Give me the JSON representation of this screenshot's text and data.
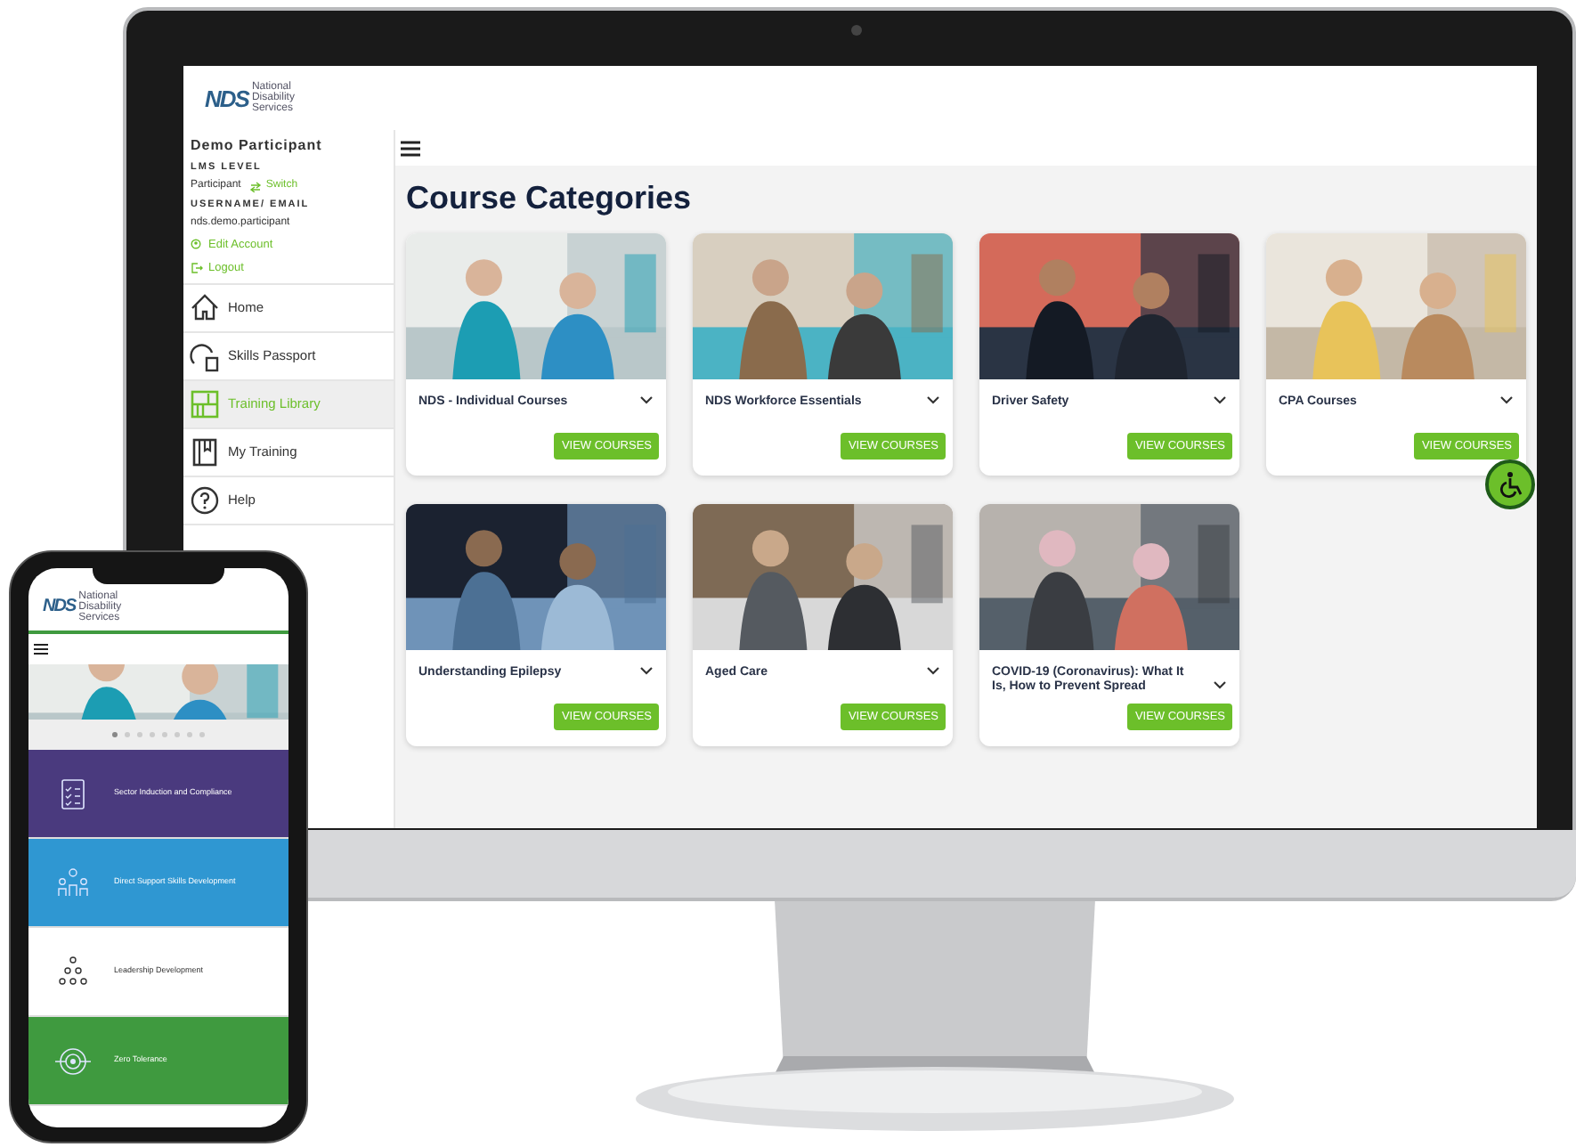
{
  "desktop": {
    "logo": {
      "mark": "NDS",
      "lines": [
        "National",
        "Disability",
        "Services"
      ]
    },
    "user": {
      "name": "Demo Participant",
      "level_label": "LMS LEVEL",
      "level": "Participant",
      "switch": "Switch",
      "username_label": "USERNAME/ EMAIL",
      "username": "nds.demo.participant",
      "links": [
        "Edit Account",
        "Logout"
      ]
    },
    "nav": [
      {
        "label": "Home",
        "selected": false
      },
      {
        "label": "Skills Passport",
        "selected": false
      },
      {
        "label": "Training Library",
        "selected": true
      },
      {
        "label": "My Training",
        "selected": false
      },
      {
        "label": "Help",
        "selected": false
      }
    ],
    "title": "Course Categories",
    "courses": [
      {
        "title": "NDS - Individual Courses",
        "button": "VIEW COURSES"
      },
      {
        "title": "NDS Workforce Essentials",
        "button": "VIEW COURSES"
      },
      {
        "title": "Driver Safety",
        "button": "VIEW COURSES"
      },
      {
        "title": "CPA Courses",
        "button": "VIEW COURSES"
      },
      {
        "title": "Understanding Epilepsy",
        "button": "VIEW COURSES"
      },
      {
        "title": "Aged Care",
        "button": "VIEW COURSES"
      },
      {
        "title": "COVID-19 (Coronavirus): What It Is, How to Prevent Spread",
        "button": "VIEW COURSES"
      }
    ]
  },
  "phone": {
    "logo": {
      "mark": "NDS",
      "lines": [
        "National",
        "Disability",
        "Services"
      ]
    },
    "carousel_dots": [
      {
        "selected": true
      },
      {
        "selected": false
      },
      {
        "selected": false
      },
      {
        "selected": false
      },
      {
        "selected": false
      },
      {
        "selected": false
      },
      {
        "selected": false
      },
      {
        "selected": false
      }
    ],
    "categories": [
      {
        "label": "Sector Induction and Compliance",
        "color": "#4a3a7e"
      },
      {
        "label": "Direct Support Skills Development",
        "color": "#2f97d2"
      },
      {
        "label": "Leadership Development",
        "color": "#ffffff"
      },
      {
        "label": "Zero Tolerance",
        "color": "#3f9a3f"
      }
    ]
  }
}
